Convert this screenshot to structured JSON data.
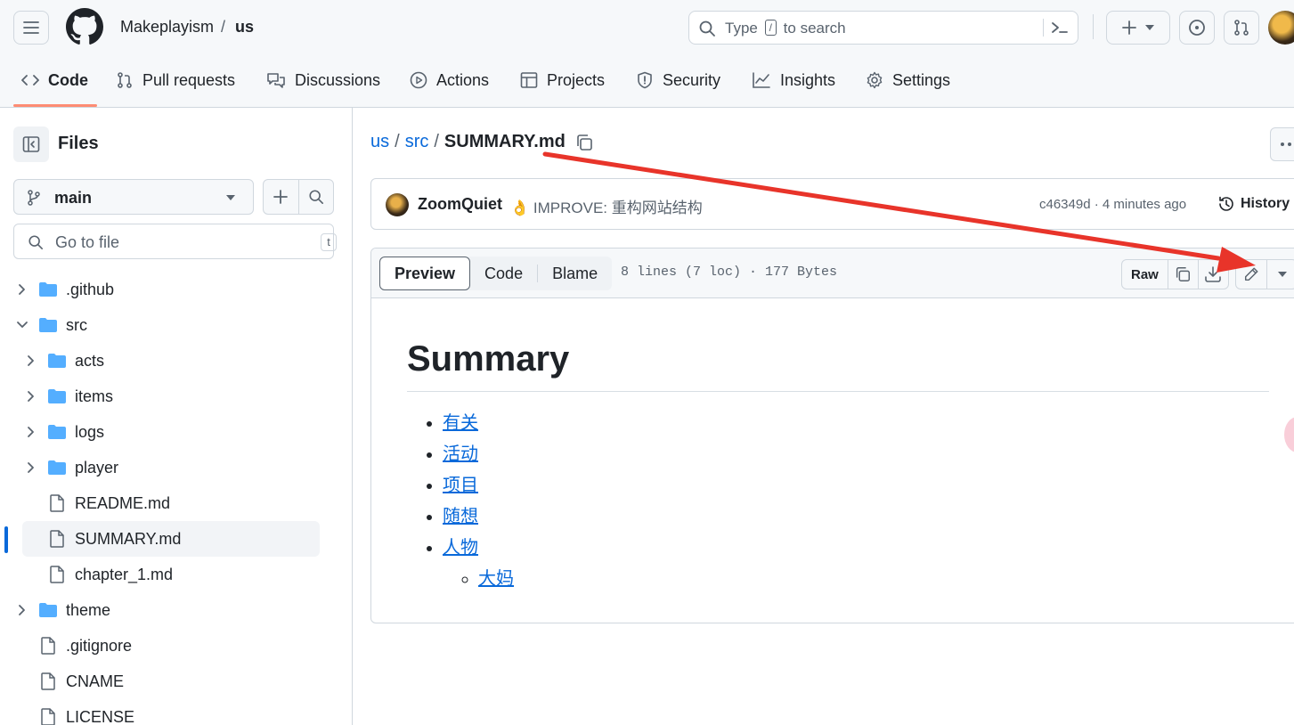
{
  "header": {
    "owner": "Makeplayism",
    "separator": "/",
    "repo": "us",
    "search_prefix": "Type",
    "search_key": "/",
    "search_suffix": "to search"
  },
  "repo_nav": {
    "tabs": [
      {
        "label": "Code",
        "icon": "code-icon",
        "active": true
      },
      {
        "label": "Pull requests",
        "icon": "pull-request-icon"
      },
      {
        "label": "Discussions",
        "icon": "discussions-icon"
      },
      {
        "label": "Actions",
        "icon": "play-icon"
      },
      {
        "label": "Projects",
        "icon": "table-icon"
      },
      {
        "label": "Security",
        "icon": "shield-icon"
      },
      {
        "label": "Insights",
        "icon": "graph-icon"
      },
      {
        "label": "Settings",
        "icon": "gear-icon"
      }
    ]
  },
  "sidebar": {
    "title": "Files",
    "branch": "main",
    "goto_placeholder": "Go to file",
    "goto_shortcut": "t",
    "tree": [
      {
        "name": ".github",
        "type": "folder",
        "expanded": false,
        "level": 0
      },
      {
        "name": "src",
        "type": "folder",
        "expanded": true,
        "level": 0
      },
      {
        "name": "acts",
        "type": "folder",
        "expanded": false,
        "level": 1
      },
      {
        "name": "items",
        "type": "folder",
        "expanded": false,
        "level": 1
      },
      {
        "name": "logs",
        "type": "folder",
        "expanded": false,
        "level": 1
      },
      {
        "name": "player",
        "type": "folder",
        "expanded": false,
        "level": 1
      },
      {
        "name": "README.md",
        "type": "file",
        "level": 1
      },
      {
        "name": "SUMMARY.md",
        "type": "file",
        "level": 1,
        "selected": true
      },
      {
        "name": "chapter_1.md",
        "type": "file",
        "level": 1
      },
      {
        "name": "theme",
        "type": "folder",
        "expanded": false,
        "level": 0
      },
      {
        "name": ".gitignore",
        "type": "file",
        "level": 0
      },
      {
        "name": "CNAME",
        "type": "file",
        "level": 0
      },
      {
        "name": "LICENSE",
        "type": "file",
        "level": 0
      }
    ]
  },
  "breadcrumb": {
    "repo": "us",
    "sep": "/",
    "folder": "src",
    "file": "SUMMARY.md"
  },
  "commit": {
    "author": "ZoomQuiet",
    "emoji": "👌",
    "message": "IMPROVE: 重构网站结构",
    "sha_time": "c46349d · 4 minutes ago",
    "history_label": "History"
  },
  "file_view": {
    "tabs": [
      "Preview",
      "Code",
      "Blame"
    ],
    "active_tab": "Preview",
    "info": "8 lines (7 loc) · 177 Bytes",
    "raw_label": "Raw"
  },
  "markdown": {
    "heading": "Summary",
    "items": [
      "有关",
      "活动",
      "项目",
      "随想",
      "人物"
    ],
    "sub_items": [
      "大妈"
    ]
  },
  "colors": {
    "accent": "#0969da",
    "tab_underline": "#fd8c73",
    "annotation_arrow": "#e8342a",
    "folder": "#54aeff"
  }
}
